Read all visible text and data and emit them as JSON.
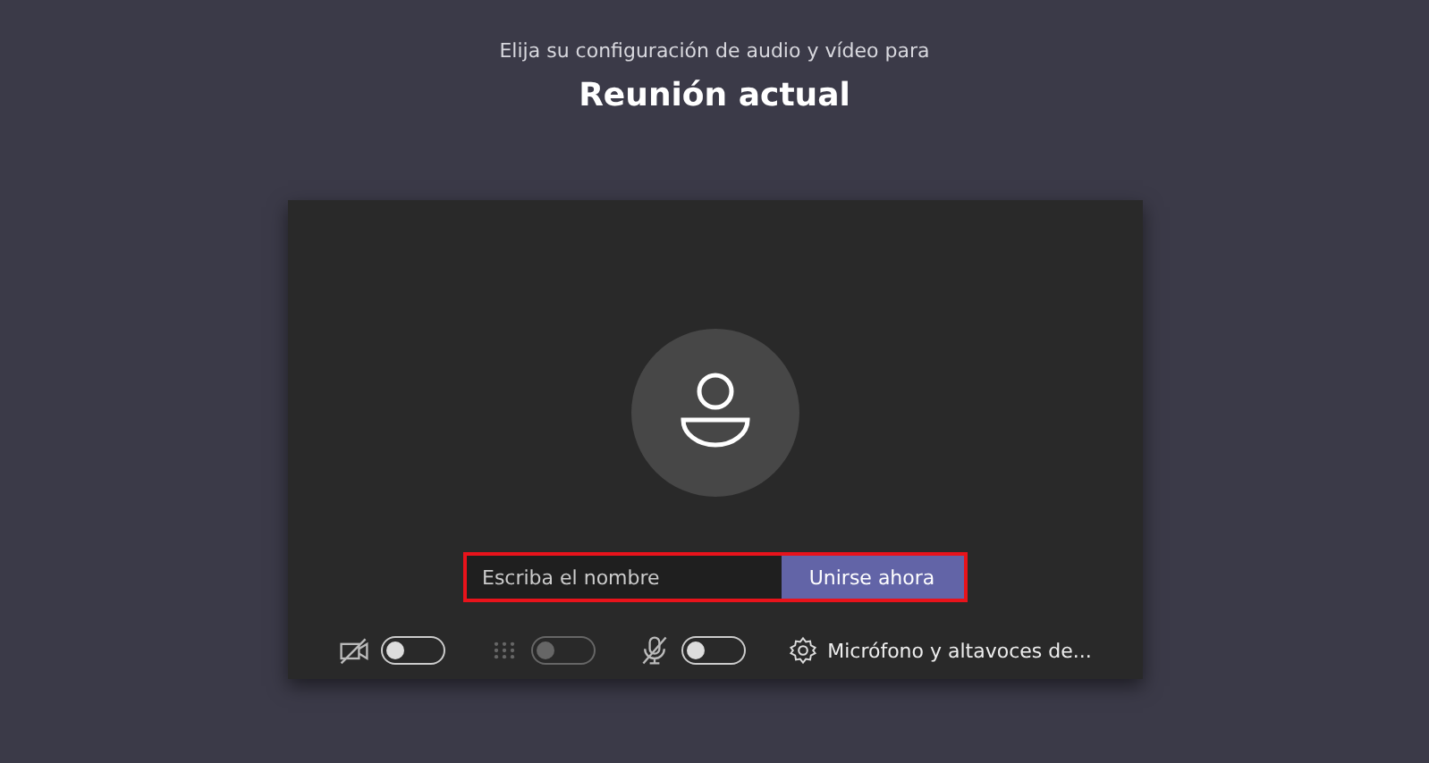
{
  "header": {
    "subtitle": "Elija su configuración de audio y vídeo para",
    "title": "Reunión actual"
  },
  "join_form": {
    "placeholder": "Escriba el nombre",
    "button": "Unirse ahora",
    "highlighted": true
  },
  "toggles": [
    {
      "kind": "camera",
      "on": false,
      "disabled": false
    },
    {
      "kind": "blur",
      "on": false,
      "disabled": true
    },
    {
      "kind": "mic",
      "on": false,
      "disabled": false
    }
  ],
  "device_settings": {
    "label": "Micrófono y altavoces de..."
  }
}
